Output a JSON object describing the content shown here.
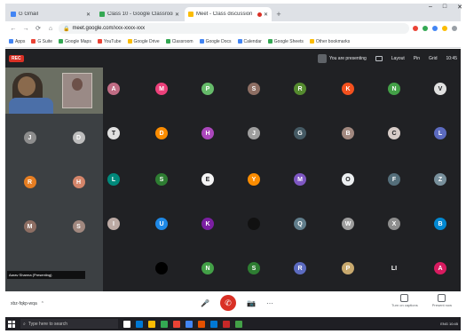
{
  "browser": {
    "tabs": [
      {
        "label": "G Gmail",
        "favicon_color": "#4285f4",
        "active": false
      },
      {
        "label": "Class 10 - Google Classroom",
        "favicon_color": "#34a853",
        "active": false
      },
      {
        "label": "Meet - Class discussion",
        "favicon_color": "#fbbc04",
        "active": true,
        "recording": true
      }
    ],
    "new_tab_label": "+",
    "window_controls": [
      "–",
      "□",
      "✕"
    ],
    "address": "meet.google.com/xxx-xxxx-xxx",
    "nav": [
      "←",
      "→",
      "⟳",
      "⌂"
    ],
    "extension_colors": [
      "#ea4335",
      "#34a853",
      "#4285f4",
      "#fbbc04",
      "#9aa0a6"
    ],
    "bookmarks": [
      {
        "label": "Apps",
        "color": "#4285f4"
      },
      {
        "label": "G Suite",
        "color": "#ea4335"
      },
      {
        "label": "Google Maps",
        "color": "#34a853"
      },
      {
        "label": "YouTube",
        "color": "#ea4335"
      },
      {
        "label": "Google Drive",
        "color": "#fbbc04"
      },
      {
        "label": "Classroom",
        "color": "#34a853"
      },
      {
        "label": "Google Docs",
        "color": "#4285f4"
      },
      {
        "label": "Calendar",
        "color": "#4285f4"
      },
      {
        "label": "Google Sheets",
        "color": "#34a853"
      },
      {
        "label": "Other bookmarks",
        "color": "#fbbc04"
      }
    ]
  },
  "meet": {
    "rec_badge": "REC",
    "speaker_label": "You are presenting",
    "top_controls": [
      "Layout",
      "Pin",
      "Grid",
      "10:45"
    ],
    "caption": "Aarav Sharma (Presenting)",
    "meeting_code": "xbz-fqkp-wqa",
    "controls": {
      "end_call_icon": "✆",
      "more_icon": "⋯",
      "present_label": "Present now",
      "captions_label": "Turn on captions"
    }
  },
  "participants": [
    {
      "initial": "A",
      "color": "#c06c84"
    },
    {
      "initial": "M",
      "color": "#ec407a"
    },
    {
      "initial": "P",
      "color": "#66bb6a"
    },
    {
      "initial": "S",
      "color": "#8d6e63"
    },
    {
      "initial": "R",
      "color": "#558b2f"
    },
    {
      "initial": "K",
      "color": "#f4511e"
    },
    {
      "initial": "N",
      "color": "#43a047"
    },
    {
      "initial": "V",
      "color": "#e0e0e0"
    },
    {
      "initial": "T",
      "color": "#e0e0e0"
    },
    {
      "initial": "D",
      "color": "#fb8c00"
    },
    {
      "initial": "H",
      "color": "#ab47bc"
    },
    {
      "initial": "J",
      "color": "#9e9e9e"
    },
    {
      "initial": "G",
      "color": "#455a64"
    },
    {
      "initial": "B",
      "color": "#a1887f"
    },
    {
      "initial": "C",
      "color": "#d7ccc8"
    },
    {
      "initial": "L",
      "color": "#5c6bc0"
    },
    {
      "initial": "L",
      "color": "#00897b"
    },
    {
      "initial": "S",
      "color": "#2e7d32"
    },
    {
      "initial": "E",
      "color": "#f5f5f5"
    },
    {
      "initial": "Y",
      "color": "#fb8c00"
    },
    {
      "initial": "M",
      "color": "#7e57c2"
    },
    {
      "initial": "O",
      "color": "#eceff1"
    },
    {
      "initial": "F",
      "color": "#546e7a"
    },
    {
      "initial": "Z",
      "color": "#78909c"
    },
    {
      "initial": "I",
      "color": "#bcaaa4"
    },
    {
      "initial": "U",
      "color": "#1e88e5"
    },
    {
      "initial": "K",
      "color": "#7b1fa2"
    },
    {
      "initial": "",
      "color": "#111111"
    },
    {
      "initial": "Q",
      "color": "#607d8b"
    },
    {
      "initial": "W",
      "color": "#9e9e9e"
    },
    {
      "initial": "X",
      "color": "#8d8d8d"
    },
    {
      "initial": "B",
      "color": "#0288d1"
    },
    {
      "initial": "",
      "color": "#000000"
    },
    {
      "initial": "N",
      "color": "#43a047"
    },
    {
      "initial": "S",
      "color": "#2e7d32"
    },
    {
      "initial": "R",
      "color": "#5c6bc0"
    },
    {
      "initial": "P",
      "color": "#c8a96e"
    },
    {
      "initial": "LI",
      "color": "#202124"
    },
    {
      "initial": "A",
      "color": "#d81b60"
    }
  ],
  "left_participants": [
    {
      "initial": "J",
      "color": "#8d8d8d"
    },
    {
      "initial": "D",
      "color": "#bdbdbd"
    },
    {
      "initial": "R",
      "color": "#e67e22"
    },
    {
      "initial": "H",
      "color": "#d4856a"
    },
    {
      "initial": "M",
      "color": "#8d6e63"
    },
    {
      "initial": "S",
      "color": "#a1887f"
    }
  ],
  "taskbar": {
    "search_placeholder": "Type here to search",
    "app_colors": [
      "#ffffff",
      "#0078d4",
      "#fbbc04",
      "#34a853",
      "#ea4335",
      "#4285f4",
      "#e65100",
      "#0078d4",
      "#c62828",
      "#43a047"
    ],
    "tray_text": "ENG  10:45"
  }
}
